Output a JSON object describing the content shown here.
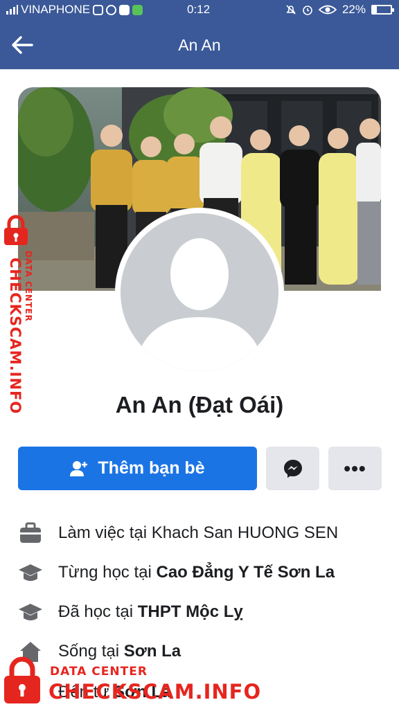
{
  "status_bar": {
    "carrier": "VINAPHONE",
    "time": "0:12",
    "battery": "22%",
    "battery_level": 0.22,
    "icons": [
      "signal-icon",
      "instagram-icon",
      "messenger-icon",
      "chat-icon",
      "message-icon",
      "mute-icon",
      "alarm-icon",
      "eye-icon",
      "battery-icon"
    ]
  },
  "header": {
    "title": "An An",
    "back_icon": "back-arrow-icon",
    "color": "#3b5998"
  },
  "profile": {
    "name": "An An (Đạt Oái)"
  },
  "actions": {
    "add_friend_label": "Thêm bạn bè",
    "add_friend_icon": "add-friend-icon",
    "message_icon": "messenger-icon",
    "more_label": "•••",
    "accent": "#1b74e4"
  },
  "info": {
    "work_prefix": "Làm việc tại ",
    "work_place": "Khach San HUONG SEN",
    "studied_prefix": "Từng học tại ",
    "studied_place": "Cao Đẳng Y Tế Sơn La",
    "school_prefix": "Đã học tại ",
    "school_place": "THPT Mộc Lỵ",
    "lives_prefix": "Sống tại ",
    "lives_place": "Sơn La",
    "from_prefix": "Đến từ ",
    "from_place": "Sơn La"
  },
  "watermark": {
    "brand": "CHECKSCAM.INFO",
    "tag": "DATA CENTER",
    "color": "#e5261f"
  }
}
